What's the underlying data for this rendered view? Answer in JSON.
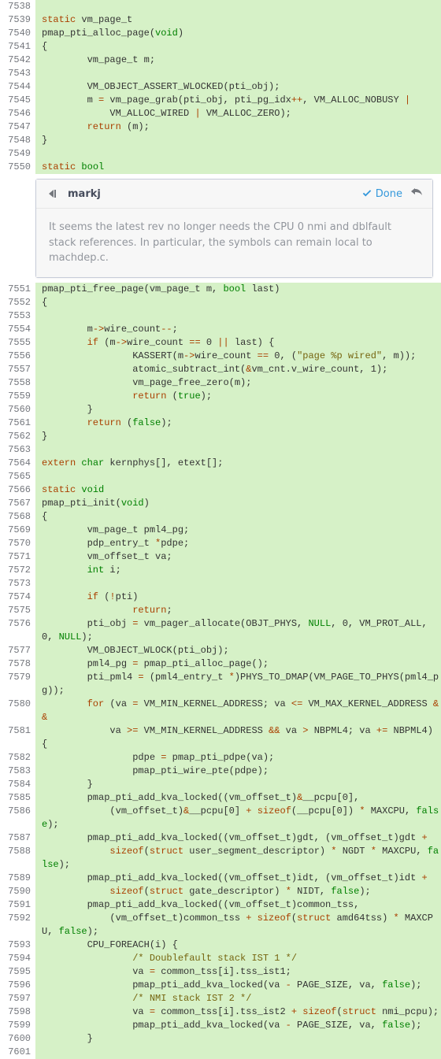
{
  "comment": {
    "author": "markj",
    "done_label": "Done",
    "body": "It seems the latest rev no longer needs the CPU 0 nmi and dblfault stack references. In particular, the symbols can remain local to machdep.c."
  },
  "lines": [
    {
      "no": "7538",
      "tokens": []
    },
    {
      "no": "7539",
      "tokens": [
        [
          "k",
          "static"
        ],
        [
          "p",
          " vm_page_t"
        ]
      ]
    },
    {
      "no": "7540",
      "tokens": [
        [
          "p",
          "pmap_pti_alloc_page("
        ],
        [
          "t",
          "void"
        ],
        [
          "p",
          ")"
        ]
      ]
    },
    {
      "no": "7541",
      "tokens": [
        [
          "p",
          "{"
        ]
      ]
    },
    {
      "no": "7542",
      "tokens": [
        [
          "p",
          "        vm_page_t m;"
        ]
      ]
    },
    {
      "no": "7543",
      "tokens": []
    },
    {
      "no": "7544",
      "tokens": [
        [
          "p",
          "        VM_OBJECT_ASSERT_WLOCKED(pti_obj);"
        ]
      ]
    },
    {
      "no": "7545",
      "tokens": [
        [
          "p",
          "        m "
        ],
        [
          "k",
          "="
        ],
        [
          "p",
          " vm_page_grab(pti_obj, pti_pg_idx"
        ],
        [
          "k",
          "++"
        ],
        [
          "p",
          ", VM_ALLOC_NOBUSY "
        ],
        [
          "k",
          "|"
        ]
      ]
    },
    {
      "no": "7546",
      "tokens": [
        [
          "p",
          "            VM_ALLOC_WIRED "
        ],
        [
          "k",
          "|"
        ],
        [
          "p",
          " VM_ALLOC_ZERO);"
        ]
      ]
    },
    {
      "no": "7547",
      "tokens": [
        [
          "p",
          "        "
        ],
        [
          "k",
          "return"
        ],
        [
          "p",
          " (m);"
        ]
      ]
    },
    {
      "no": "7548",
      "tokens": [
        [
          "p",
          "}"
        ]
      ]
    },
    {
      "no": "7549",
      "tokens": []
    },
    {
      "no": "7550",
      "tokens": [
        [
          "k",
          "static"
        ],
        [
          "p",
          " "
        ],
        [
          "t",
          "bool"
        ]
      ]
    },
    {
      "type": "comment"
    },
    {
      "no": "7551",
      "tokens": [
        [
          "p",
          "pmap_pti_free_page(vm_page_t m, "
        ],
        [
          "t",
          "bool"
        ],
        [
          "p",
          " last)"
        ]
      ]
    },
    {
      "no": "7552",
      "tokens": [
        [
          "p",
          "{"
        ]
      ]
    },
    {
      "no": "7553",
      "tokens": []
    },
    {
      "no": "7554",
      "tokens": [
        [
          "p",
          "        m"
        ],
        [
          "k",
          "->"
        ],
        [
          "p",
          "wire_count"
        ],
        [
          "k",
          "--"
        ],
        [
          "p",
          ";"
        ]
      ]
    },
    {
      "no": "7555",
      "tokens": [
        [
          "p",
          "        "
        ],
        [
          "k",
          "if"
        ],
        [
          "p",
          " (m"
        ],
        [
          "k",
          "->"
        ],
        [
          "p",
          "wire_count "
        ],
        [
          "k",
          "=="
        ],
        [
          "p",
          " "
        ],
        [
          "n",
          "0"
        ],
        [
          "p",
          " "
        ],
        [
          "k",
          "||"
        ],
        [
          "p",
          " last) {"
        ]
      ]
    },
    {
      "no": "7556",
      "tokens": [
        [
          "p",
          "                KASSERT(m"
        ],
        [
          "k",
          "->"
        ],
        [
          "p",
          "wire_count "
        ],
        [
          "k",
          "=="
        ],
        [
          "p",
          " "
        ],
        [
          "n",
          "0"
        ],
        [
          "p",
          ", ("
        ],
        [
          "s",
          "\"page %p wired\""
        ],
        [
          "p",
          ", m));"
        ]
      ]
    },
    {
      "no": "7557",
      "tokens": [
        [
          "p",
          "                atomic_subtract_int("
        ],
        [
          "k",
          "&"
        ],
        [
          "p",
          "vm_cnt.v_wire_count, "
        ],
        [
          "n",
          "1"
        ],
        [
          "p",
          ");"
        ]
      ]
    },
    {
      "no": "7558",
      "tokens": [
        [
          "p",
          "                vm_page_free_zero(m);"
        ]
      ]
    },
    {
      "no": "7559",
      "tokens": [
        [
          "p",
          "                "
        ],
        [
          "k",
          "return"
        ],
        [
          "p",
          " ("
        ],
        [
          "nul",
          "true"
        ],
        [
          "p",
          ");"
        ]
      ]
    },
    {
      "no": "7560",
      "tokens": [
        [
          "p",
          "        }"
        ]
      ]
    },
    {
      "no": "7561",
      "tokens": [
        [
          "p",
          "        "
        ],
        [
          "k",
          "return"
        ],
        [
          "p",
          " ("
        ],
        [
          "nul",
          "false"
        ],
        [
          "p",
          ");"
        ]
      ]
    },
    {
      "no": "7562",
      "tokens": [
        [
          "p",
          "}"
        ]
      ]
    },
    {
      "no": "7563",
      "tokens": []
    },
    {
      "no": "7564",
      "tokens": [
        [
          "k",
          "extern"
        ],
        [
          "p",
          " "
        ],
        [
          "t",
          "char"
        ],
        [
          "p",
          " kernphys[], etext[];"
        ]
      ]
    },
    {
      "no": "7565",
      "tokens": []
    },
    {
      "no": "7566",
      "tokens": [
        [
          "k",
          "static"
        ],
        [
          "p",
          " "
        ],
        [
          "t",
          "void"
        ]
      ]
    },
    {
      "no": "7567",
      "tokens": [
        [
          "p",
          "pmap_pti_init("
        ],
        [
          "t",
          "void"
        ],
        [
          "p",
          ")"
        ]
      ]
    },
    {
      "no": "7568",
      "tokens": [
        [
          "p",
          "{"
        ]
      ]
    },
    {
      "no": "7569",
      "tokens": [
        [
          "p",
          "        vm_page_t pml4_pg;"
        ]
      ]
    },
    {
      "no": "7570",
      "tokens": [
        [
          "p",
          "        pdp_entry_t "
        ],
        [
          "k",
          "*"
        ],
        [
          "p",
          "pdpe;"
        ]
      ]
    },
    {
      "no": "7571",
      "tokens": [
        [
          "p",
          "        vm_offset_t va;"
        ]
      ]
    },
    {
      "no": "7572",
      "tokens": [
        [
          "p",
          "        "
        ],
        [
          "t",
          "int"
        ],
        [
          "p",
          " i;"
        ]
      ]
    },
    {
      "no": "7573",
      "tokens": []
    },
    {
      "no": "7574",
      "tokens": [
        [
          "p",
          "        "
        ],
        [
          "k",
          "if"
        ],
        [
          "p",
          " ("
        ],
        [
          "k",
          "!"
        ],
        [
          "p",
          "pti)"
        ]
      ]
    },
    {
      "no": "7575",
      "tokens": [
        [
          "p",
          "                "
        ],
        [
          "k",
          "return"
        ],
        [
          "p",
          ";"
        ]
      ]
    },
    {
      "no": "7576",
      "tokens": [
        [
          "p",
          "        pti_obj "
        ],
        [
          "k",
          "="
        ],
        [
          "p",
          " vm_pager_allocate(OBJT_PHYS, "
        ],
        [
          "nul",
          "NULL"
        ],
        [
          "p",
          ", "
        ],
        [
          "n",
          "0"
        ],
        [
          "p",
          ", VM_PROT_ALL, "
        ],
        [
          "n",
          "0"
        ],
        [
          "p",
          ", "
        ],
        [
          "nul",
          "NULL"
        ],
        [
          "p",
          ");"
        ]
      ]
    },
    {
      "no": "7577",
      "tokens": [
        [
          "p",
          "        VM_OBJECT_WLOCK(pti_obj);"
        ]
      ]
    },
    {
      "no": "7578",
      "tokens": [
        [
          "p",
          "        pml4_pg "
        ],
        [
          "k",
          "="
        ],
        [
          "p",
          " pmap_pti_alloc_page();"
        ]
      ]
    },
    {
      "no": "7579",
      "tokens": [
        [
          "p",
          "        pti_pml4 "
        ],
        [
          "k",
          "="
        ],
        [
          "p",
          " (pml4_entry_t "
        ],
        [
          "k",
          "*"
        ],
        [
          "p",
          ")PHYS_TO_DMAP(VM_PAGE_TO_PHYS(pml4_pg));"
        ]
      ]
    },
    {
      "no": "7580",
      "tokens": [
        [
          "p",
          "        "
        ],
        [
          "k",
          "for"
        ],
        [
          "p",
          " (va "
        ],
        [
          "k",
          "="
        ],
        [
          "p",
          " VM_MIN_KERNEL_ADDRESS; va "
        ],
        [
          "k",
          "<="
        ],
        [
          "p",
          " VM_MAX_KERNEL_ADDRESS "
        ],
        [
          "k",
          "&&"
        ]
      ]
    },
    {
      "no": "7581",
      "tokens": [
        [
          "p",
          "            va "
        ],
        [
          "k",
          ">="
        ],
        [
          "p",
          " VM_MIN_KERNEL_ADDRESS "
        ],
        [
          "k",
          "&&"
        ],
        [
          "p",
          " va "
        ],
        [
          "k",
          ">"
        ],
        [
          "p",
          " NBPML4; va "
        ],
        [
          "k",
          "+="
        ],
        [
          "p",
          " NBPML4) {"
        ]
      ]
    },
    {
      "no": "7582",
      "tokens": [
        [
          "p",
          "                pdpe "
        ],
        [
          "k",
          "="
        ],
        [
          "p",
          " pmap_pti_pdpe(va);"
        ]
      ]
    },
    {
      "no": "7583",
      "tokens": [
        [
          "p",
          "                pmap_pti_wire_pte(pdpe);"
        ]
      ]
    },
    {
      "no": "7584",
      "tokens": [
        [
          "p",
          "        }"
        ]
      ]
    },
    {
      "no": "7585",
      "tokens": [
        [
          "p",
          "        pmap_pti_add_kva_locked((vm_offset_t)"
        ],
        [
          "k",
          "&"
        ],
        [
          "p",
          "__pcpu["
        ],
        [
          "n",
          "0"
        ],
        [
          "p",
          "],"
        ]
      ]
    },
    {
      "no": "7586",
      "tokens": [
        [
          "p",
          "            (vm_offset_t)"
        ],
        [
          "k",
          "&"
        ],
        [
          "p",
          "__pcpu["
        ],
        [
          "n",
          "0"
        ],
        [
          "p",
          "] "
        ],
        [
          "k",
          "+"
        ],
        [
          "p",
          " "
        ],
        [
          "k",
          "sizeof"
        ],
        [
          "p",
          "(__pcpu["
        ],
        [
          "n",
          "0"
        ],
        [
          "p",
          "]) "
        ],
        [
          "k",
          "*"
        ],
        [
          "p",
          " MAXCPU, "
        ],
        [
          "nul",
          "false"
        ],
        [
          "p",
          ");"
        ]
      ]
    },
    {
      "no": "7587",
      "tokens": [
        [
          "p",
          "        pmap_pti_add_kva_locked((vm_offset_t)gdt, (vm_offset_t)gdt "
        ],
        [
          "k",
          "+"
        ]
      ]
    },
    {
      "no": "7588",
      "tokens": [
        [
          "p",
          "            "
        ],
        [
          "k",
          "sizeof"
        ],
        [
          "p",
          "("
        ],
        [
          "k",
          "struct"
        ],
        [
          "p",
          " user_segment_descriptor) "
        ],
        [
          "k",
          "*"
        ],
        [
          "p",
          " NGDT "
        ],
        [
          "k",
          "*"
        ],
        [
          "p",
          " MAXCPU, "
        ],
        [
          "nul",
          "false"
        ],
        [
          "p",
          ");"
        ]
      ]
    },
    {
      "no": "7589",
      "tokens": [
        [
          "p",
          "        pmap_pti_add_kva_locked((vm_offset_t)idt, (vm_offset_t)idt "
        ],
        [
          "k",
          "+"
        ]
      ]
    },
    {
      "no": "7590",
      "tokens": [
        [
          "p",
          "            "
        ],
        [
          "k",
          "sizeof"
        ],
        [
          "p",
          "("
        ],
        [
          "k",
          "struct"
        ],
        [
          "p",
          " gate_descriptor) "
        ],
        [
          "k",
          "*"
        ],
        [
          "p",
          " NIDT, "
        ],
        [
          "nul",
          "false"
        ],
        [
          "p",
          ");"
        ]
      ]
    },
    {
      "no": "7591",
      "tokens": [
        [
          "p",
          "        pmap_pti_add_kva_locked((vm_offset_t)common_tss,"
        ]
      ]
    },
    {
      "no": "7592",
      "tokens": [
        [
          "p",
          "            (vm_offset_t)common_tss "
        ],
        [
          "k",
          "+"
        ],
        [
          "p",
          " "
        ],
        [
          "k",
          "sizeof"
        ],
        [
          "p",
          "("
        ],
        [
          "k",
          "struct"
        ],
        [
          "p",
          " amd64tss) "
        ],
        [
          "k",
          "*"
        ],
        [
          "p",
          " MAXCPU, "
        ],
        [
          "nul",
          "false"
        ],
        [
          "p",
          ");"
        ]
      ]
    },
    {
      "no": "7593",
      "tokens": [
        [
          "p",
          "        CPU_FOREACH(i) {"
        ]
      ]
    },
    {
      "no": "7594",
      "tokens": [
        [
          "p",
          "                "
        ],
        [
          "s",
          "/* Doublefault stack IST 1 */"
        ]
      ]
    },
    {
      "no": "7595",
      "tokens": [
        [
          "p",
          "                va "
        ],
        [
          "k",
          "="
        ],
        [
          "p",
          " common_tss[i].tss_ist1;"
        ]
      ]
    },
    {
      "no": "7596",
      "tokens": [
        [
          "p",
          "                pmap_pti_add_kva_locked(va "
        ],
        [
          "k",
          "-"
        ],
        [
          "p",
          " PAGE_SIZE, va, "
        ],
        [
          "nul",
          "false"
        ],
        [
          "p",
          ");"
        ]
      ]
    },
    {
      "no": "7597",
      "tokens": [
        [
          "p",
          "                "
        ],
        [
          "s",
          "/* NMI stack IST 2 */"
        ]
      ]
    },
    {
      "no": "7598",
      "tokens": [
        [
          "p",
          "                va "
        ],
        [
          "k",
          "="
        ],
        [
          "p",
          " common_tss[i].tss_ist2 "
        ],
        [
          "k",
          "+"
        ],
        [
          "p",
          " "
        ],
        [
          "k",
          "sizeof"
        ],
        [
          "p",
          "("
        ],
        [
          "k",
          "struct"
        ],
        [
          "p",
          " nmi_pcpu);"
        ]
      ]
    },
    {
      "no": "7599",
      "tokens": [
        [
          "p",
          "                pmap_pti_add_kva_locked(va "
        ],
        [
          "k",
          "-"
        ],
        [
          "p",
          " PAGE_SIZE, va, "
        ],
        [
          "nul",
          "false"
        ],
        [
          "p",
          ");"
        ]
      ]
    },
    {
      "no": "7600",
      "tokens": [
        [
          "p",
          "        }"
        ]
      ]
    },
    {
      "no": "7601",
      "tokens": []
    }
  ]
}
